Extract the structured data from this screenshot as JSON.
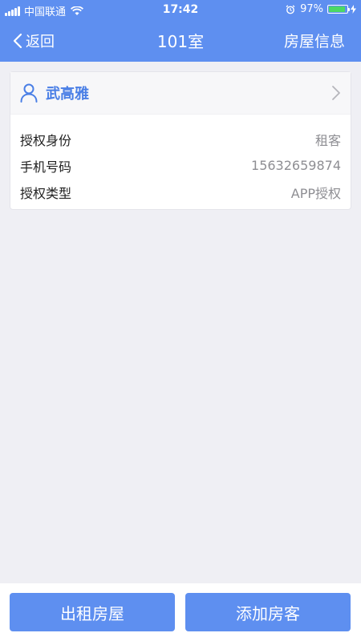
{
  "status_bar": {
    "carrier": "中国联通",
    "time": "17:42",
    "battery": "97%"
  },
  "nav": {
    "back_label": "返回",
    "title": "101室",
    "right_action": "房屋信息"
  },
  "tenant_card": {
    "name": "武高雅",
    "rows": [
      {
        "label": "授权身份",
        "value": "租客"
      },
      {
        "label": "手机号码",
        "value": "15632659874"
      },
      {
        "label": "授权类型",
        "value": "APP授权"
      }
    ]
  },
  "footer": {
    "rent_button": "出租房屋",
    "add_tenant_button": "添加房客"
  },
  "colors": {
    "primary": "#5e8ff0",
    "name_blue": "#4a7fe6",
    "background": "#efeff4"
  }
}
